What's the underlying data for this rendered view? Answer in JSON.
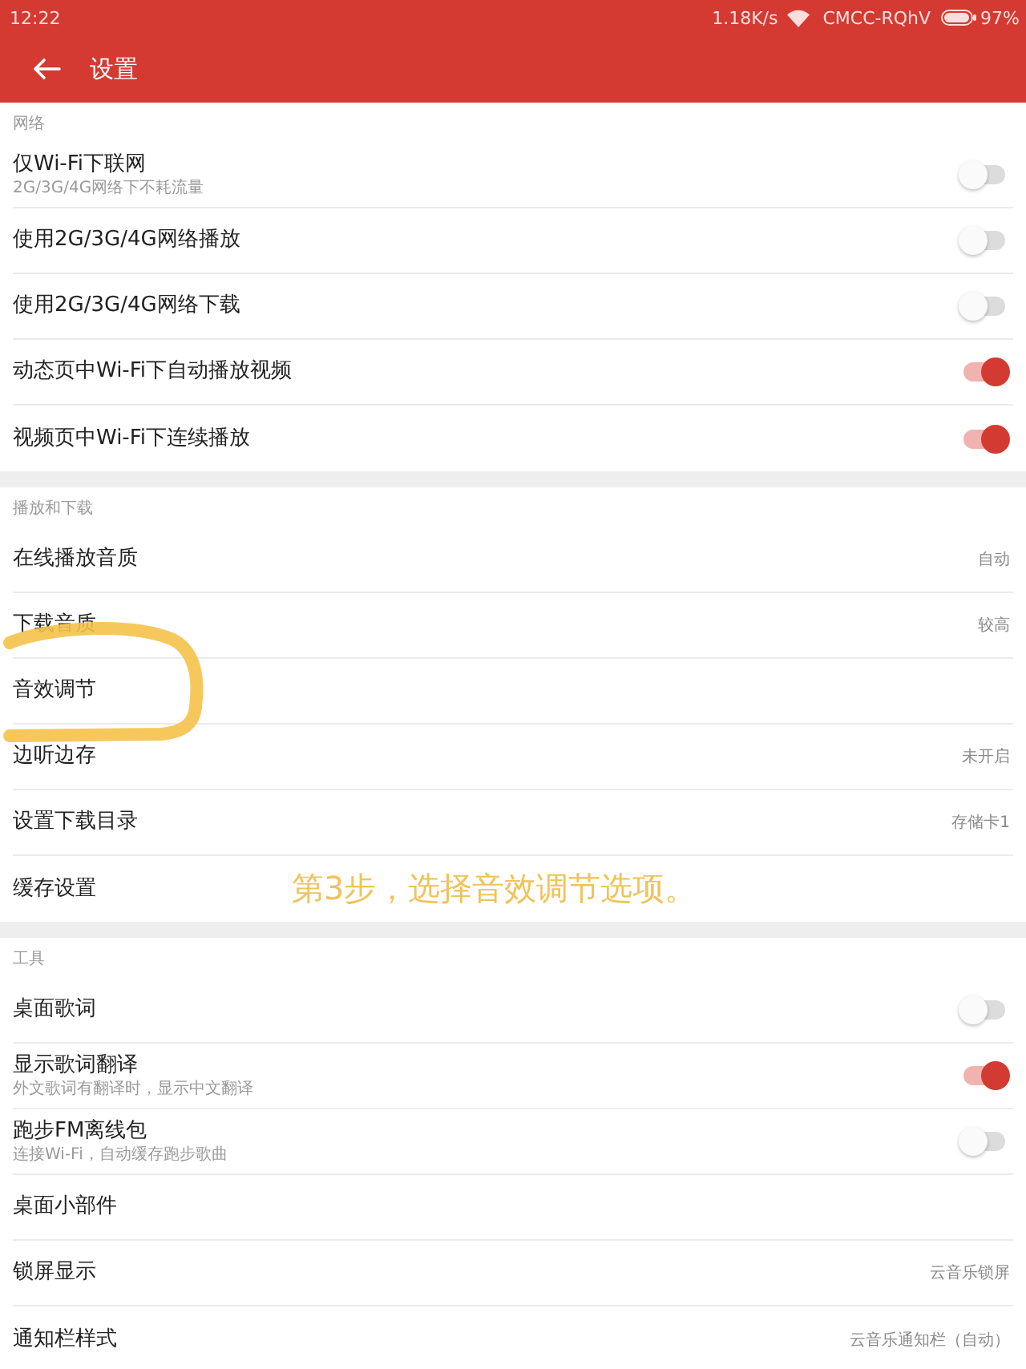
{
  "status_bar": {
    "time": "12:22",
    "speed": "1.18K/s",
    "network": "CMCC-RQhV",
    "battery": "97%"
  },
  "header": {
    "title": "设置"
  },
  "sections": [
    {
      "title": "网络",
      "items": [
        {
          "kind": "toggle",
          "label": "仅Wi-Fi下联网",
          "subtitle": "2G/3G/4G网络下不耗流量",
          "on": false
        },
        {
          "kind": "toggle",
          "label": "使用2G/3G/4G网络播放",
          "on": false
        },
        {
          "kind": "toggle",
          "label": "使用2G/3G/4G网络下载",
          "on": false
        },
        {
          "kind": "toggle",
          "label": "动态页中Wi-Fi下自动播放视频",
          "on": true
        },
        {
          "kind": "toggle",
          "label": "视频页中Wi-Fi下连续播放",
          "on": true
        }
      ]
    },
    {
      "title": "播放和下载",
      "items": [
        {
          "kind": "option",
          "label": "在线播放音质",
          "value": "自动"
        },
        {
          "kind": "option",
          "label": "下载音质",
          "value": "较高"
        },
        {
          "kind": "option",
          "label": "音效调节"
        },
        {
          "kind": "option",
          "label": "边听边存",
          "value": "未开启"
        },
        {
          "kind": "option",
          "label": "设置下载目录",
          "value": "存储卡1"
        },
        {
          "kind": "option",
          "label": "缓存设置"
        }
      ]
    },
    {
      "title": "工具",
      "items": [
        {
          "kind": "toggle",
          "label": "桌面歌词",
          "on": false
        },
        {
          "kind": "toggle",
          "label": "显示歌词翻译",
          "subtitle": "外文歌词有翻译时，显示中文翻译",
          "on": true
        },
        {
          "kind": "toggle",
          "label": "跑步FM离线包",
          "subtitle": "连接Wi-Fi，自动缓存跑步歌曲",
          "on": false
        },
        {
          "kind": "option",
          "label": "桌面小部件"
        },
        {
          "kind": "option",
          "label": "锁屏显示",
          "value": "云音乐锁屏"
        },
        {
          "kind": "option",
          "label": "通知栏样式",
          "value": "云音乐通知栏（自动）"
        }
      ]
    }
  ],
  "annotation": {
    "caption": "第3步，选择音效调节选项。"
  }
}
